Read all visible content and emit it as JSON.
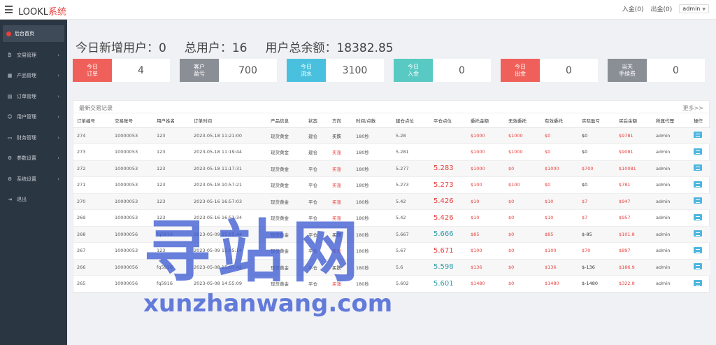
{
  "header": {
    "logo_prefix": "LOOKL",
    "logo_suffix": "系统",
    "deposit": "入金(0)",
    "withdraw": "出金(0)",
    "user": "admin"
  },
  "sidebar": {
    "items": [
      {
        "label": "后台首页",
        "icon": "dashboard-icon",
        "active": true
      },
      {
        "label": "交易管理",
        "icon": "bitcoin-icon"
      },
      {
        "label": "产品管理",
        "icon": "grid-icon"
      },
      {
        "label": "订单管理",
        "icon": "document-icon"
      },
      {
        "label": "用户管理",
        "icon": "user-icon"
      },
      {
        "label": "财务管理",
        "icon": "wallet-icon"
      },
      {
        "label": "参数设置",
        "icon": "gear-icon"
      },
      {
        "label": "系统设置",
        "icon": "cogs-icon"
      },
      {
        "label": "退出",
        "icon": "logout-icon"
      }
    ]
  },
  "stats": {
    "today_new": "今日新增用户：0",
    "total_users": "总用户：16",
    "total_balance": "用户总余额：18382.85"
  },
  "cards": [
    {
      "tag1": "今日",
      "tag2": "订单",
      "value": "4",
      "color": "#f0605a"
    },
    {
      "tag1": "客户",
      "tag2": "盈亏",
      "value": "700",
      "color": "#8a8f96"
    },
    {
      "tag1": "今日",
      "tag2": "流水",
      "value": "3100",
      "color": "#49c1de"
    },
    {
      "tag1": "今日",
      "tag2": "入金",
      "value": "0",
      "color": "#59c9c3"
    },
    {
      "tag1": "今日",
      "tag2": "出金",
      "value": "0",
      "color": "#f0605a"
    },
    {
      "tag1": "当天",
      "tag2": "手续费",
      "value": "0",
      "color": "#8a8f96"
    }
  ],
  "table": {
    "title": "最新交易记录",
    "more": "更多>>",
    "columns": [
      "订单编号",
      "交易账号",
      "用户姓名",
      "订单时间",
      "产品信息",
      "状态",
      "方向",
      "时间/点数",
      "建仓点位",
      "平仓点位",
      "委托金额",
      "无效委托",
      "有效委托",
      "实际盈亏",
      "买后余额",
      "所属代理",
      "操作"
    ],
    "rows": [
      [
        "274",
        "10000053",
        "123",
        "2023-05-18 11:21:00",
        "现货黄金",
        "建仓",
        "买跌",
        "180秒",
        "5.28",
        "",
        "$1000",
        "$1000",
        "$0",
        "$0",
        "$9781",
        "admin"
      ],
      [
        "273",
        "10000053",
        "123",
        "2023-05-18 11:19:44",
        "现货黄金",
        "建仓",
        "买涨",
        "180秒",
        "5.281",
        "",
        "$1000",
        "$1000",
        "$0",
        "$0",
        "$9081",
        "admin"
      ],
      [
        "272",
        "10000053",
        "123",
        "2023-05-18 11:17:31",
        "现货黄金",
        "平仓",
        "买涨",
        "180秒",
        "5.277",
        "5.283",
        "$1000",
        "$0",
        "$1000",
        "$700",
        "$10081",
        "admin"
      ],
      [
        "271",
        "10000053",
        "123",
        "2023-05-18 10:57:21",
        "现货黄金",
        "平仓",
        "买涨",
        "180秒",
        "5.273",
        "5.273",
        "$100",
        "$100",
        "$0",
        "$0",
        "$781",
        "admin"
      ],
      [
        "270",
        "10000053",
        "123",
        "2023-05-16 16:57:03",
        "现货黄金",
        "平仓",
        "买涨",
        "180秒",
        "5.42",
        "5.426",
        "$10",
        "$0",
        "$10",
        "$7",
        "$947",
        "admin"
      ],
      [
        "269",
        "10000053",
        "123",
        "2023-05-16 16:53:34",
        "现货黄金",
        "平仓",
        "买涨",
        "180秒",
        "5.42",
        "5.426",
        "$10",
        "$0",
        "$10",
        "$7",
        "$957",
        "admin"
      ],
      [
        "268",
        "10000056",
        "fq5916",
        "2023-05-09 15:05:44",
        "现货黄金",
        "平仓",
        "买跌",
        "180秒",
        "5.667",
        "5.666",
        "$85",
        "$0",
        "$85",
        "$-85",
        "$101.8",
        "admin"
      ],
      [
        "267",
        "10000053",
        "123",
        "2023-05-09 15:05:14",
        "现货黄金",
        "平仓",
        "买涨",
        "180秒",
        "5.67",
        "5.671",
        "$100",
        "$0",
        "$100",
        "$70",
        "$897",
        "admin"
      ],
      [
        "266",
        "10000056",
        "fq5916",
        "2023-05-08 15:07:42",
        "现货黄金",
        "平仓",
        "买跌",
        "180秒",
        "5.6",
        "5.598",
        "$136",
        "$0",
        "$136",
        "$-136",
        "$186.9",
        "admin"
      ],
      [
        "265",
        "10000056",
        "fq5916",
        "2023-05-08 14:55:09",
        "现货黄金",
        "平仓",
        "买涨",
        "180秒",
        "5.602",
        "5.601",
        "$1480",
        "$0",
        "$1480",
        "$-1480",
        "$322.8",
        "admin"
      ]
    ]
  },
  "watermark": {
    "cn": "寻站网",
    "en": "xunzhanwang.com"
  }
}
